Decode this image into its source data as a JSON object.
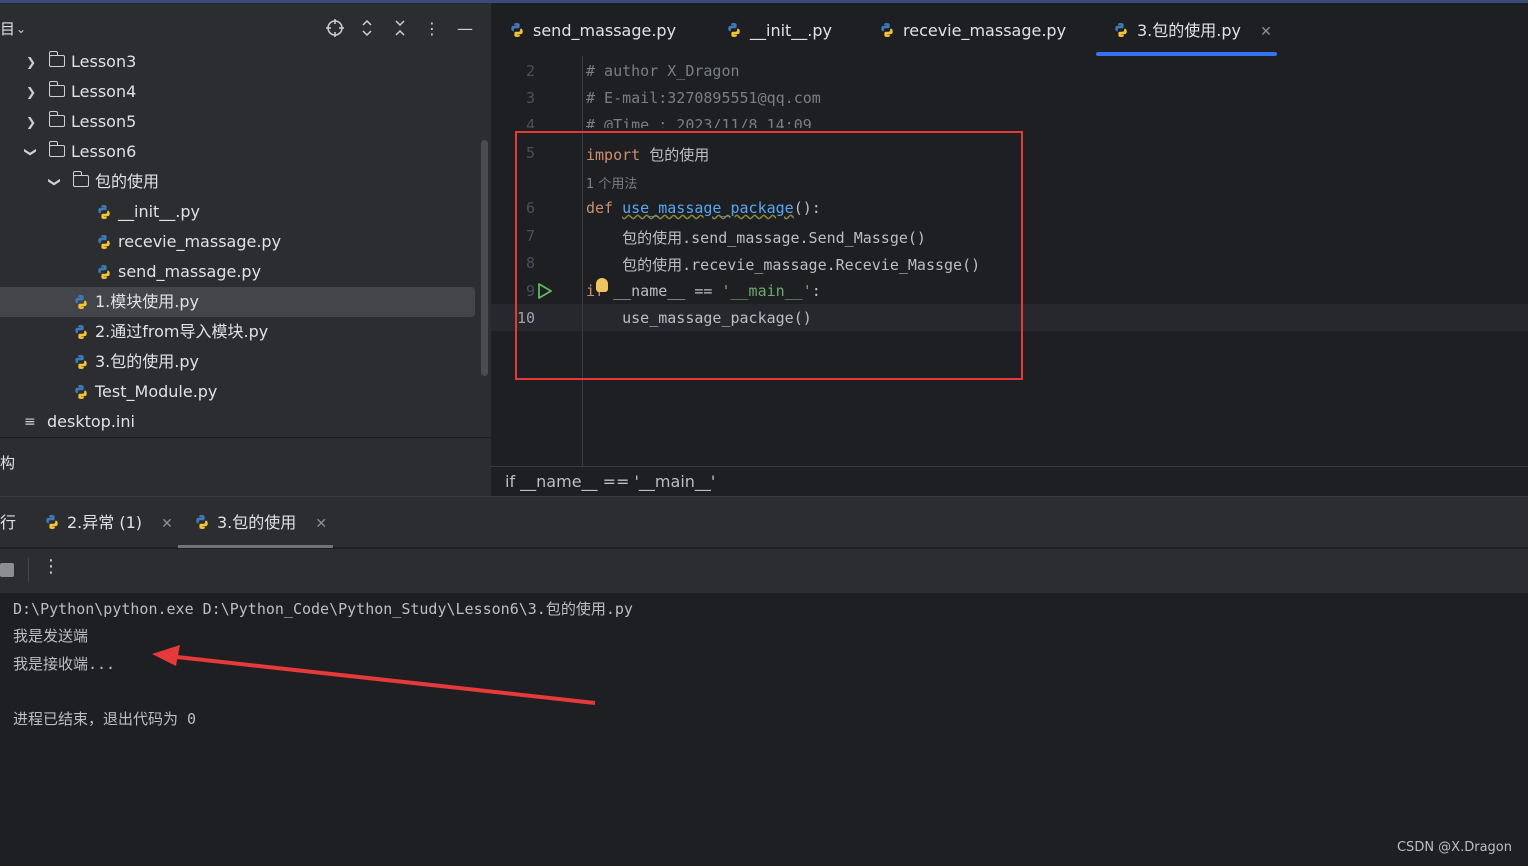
{
  "project_panel": {
    "title_glyph": "目",
    "header_icons": [
      "crosshair-icon",
      "expand-collapse-icon",
      "collapse-all-icon",
      "more-icon",
      "minimize-icon"
    ],
    "tree": [
      {
        "label": "Lesson3",
        "type": "folder",
        "expanded": false
      },
      {
        "label": "Lesson4",
        "type": "folder",
        "expanded": false
      },
      {
        "label": "Lesson5",
        "type": "folder",
        "expanded": false
      },
      {
        "label": "Lesson6",
        "type": "folder",
        "expanded": true
      },
      {
        "label": "包的使用",
        "type": "package",
        "expanded": true
      },
      {
        "label": "__init__.py",
        "type": "python"
      },
      {
        "label": "recevie_massage.py",
        "type": "python"
      },
      {
        "label": "send_massage.py",
        "type": "python"
      },
      {
        "label": "1.模块使用.py",
        "type": "python",
        "selected": true
      },
      {
        "label": "2.通过from导入模块.py",
        "type": "python"
      },
      {
        "label": "3.包的使用.py",
        "type": "python"
      },
      {
        "label": "Test_Module.py",
        "type": "python"
      },
      {
        "label": "desktop.ini",
        "type": "text"
      }
    ],
    "structure_glyph": "构"
  },
  "editor": {
    "tabs": [
      {
        "label": "send_massage.py"
      },
      {
        "label": "__init__.py"
      },
      {
        "label": "recevie_massage.py"
      },
      {
        "label": "3.包的使用.py",
        "active": true
      }
    ],
    "line_numbers": [
      "2",
      "3",
      "4",
      "5",
      "6",
      "7",
      "8",
      "9",
      "10"
    ],
    "lines": {
      "l2": "# author X_Dragon",
      "l3": "# E-mail:3270895551@qq.com",
      "l4": "# @Time : 2023/11/8 14:09",
      "l5_kw": "import",
      "l5_rest": " 包的使用",
      "usage": "1 个用法",
      "l6_kw": "def",
      "l6_fn": "use_massage_package",
      "l6_rest": "():",
      "l7": "    包的使用.send_massage.Send_Massge()",
      "l8": "    包的使用.recevie_massage.Recevie_Massge()",
      "l9_kw": "if",
      "l9_mid": " __name__ == ",
      "l9_str": "'__main__'",
      "l9_end": ":",
      "l10": "    use_massage_package()"
    },
    "breadcrumb": "if __name__ == '__main__'"
  },
  "run_panel": {
    "left_glyph": "行",
    "tabs": [
      {
        "label": "2.异常 (1)"
      },
      {
        "label": "3.包的使用",
        "active": true
      }
    ],
    "console": [
      "D:\\Python\\python.exe D:\\Python_Code\\Python_Study\\Lesson6\\3.包的使用.py",
      "我是发送端",
      "我是接收端...",
      "",
      "进程已结束，退出代码为 0"
    ]
  },
  "watermark": "CSDN @X.Dragon",
  "colors": {
    "annotation_red": "#e5393a",
    "accent_blue": "#3574f0"
  }
}
